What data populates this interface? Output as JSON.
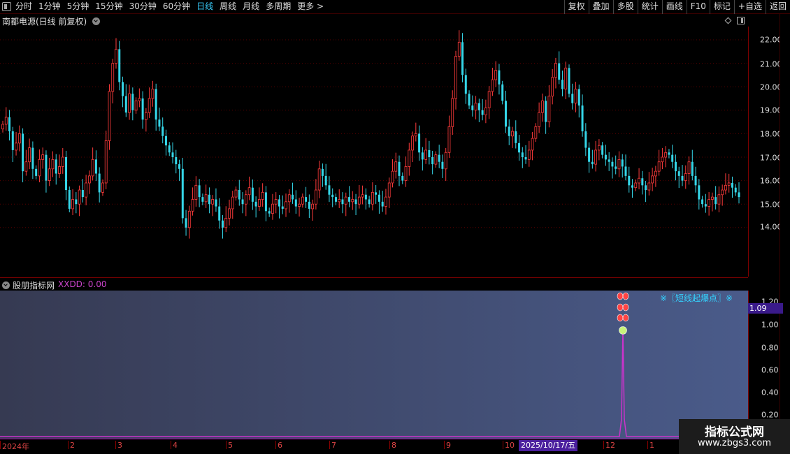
{
  "toolbar": {
    "periods": [
      "分时",
      "1分钟",
      "5分钟",
      "15分钟",
      "30分钟",
      "60分钟",
      "日线",
      "周线",
      "月线",
      "多周期",
      "更多 >"
    ],
    "active_period": "日线",
    "buttons": [
      "复权",
      "叠加",
      "多股",
      "统计",
      "画线",
      "F10",
      "标记",
      "+自选",
      "返回"
    ]
  },
  "stock": {
    "title": "南都电源(日线 前复权)"
  },
  "price_axis": [
    "22.00",
    "21.00",
    "20.00",
    "19.00",
    "18.00",
    "17.00",
    "16.00",
    "15.00",
    "14.00"
  ],
  "indicator": {
    "name": "股朋指标网",
    "value_label": "XXDD: 0.00",
    "signal_label": "※〖短线起爆点〗※",
    "axis": [
      "1.20",
      "1.00",
      "0.80",
      "0.60",
      "0.40",
      "0.20"
    ],
    "current_value": "1.09"
  },
  "date_axis": [
    "2024年",
    "2",
    "3",
    "4",
    "5",
    "6",
    "7",
    "8",
    "9",
    "10",
    "12",
    "1"
  ],
  "cursor_date": "2025/10/17/五",
  "watermark": {
    "line1": "指标公式网",
    "line2": "www.zbgs3.com"
  },
  "colors": {
    "up": "#ff3b3b",
    "down": "#35d6e8",
    "indicator_line": "#cc33cc"
  },
  "chart_data": {
    "type": "candlestick",
    "title": "南都电源(日线 前复权)",
    "ylim": [
      13.0,
      22.5
    ],
    "closes": [
      18.4,
      18.7,
      18.1,
      17.3,
      17.6,
      18.0,
      16.4,
      16.8,
      17.4,
      16.5,
      16.2,
      16.9,
      17.1,
      16.0,
      16.5,
      16.9,
      16.3,
      16.6,
      17.0,
      15.6,
      14.8,
      15.2,
      15.0,
      15.6,
      15.3,
      15.9,
      16.2,
      16.9,
      16.3,
      15.5,
      15.9,
      17.7,
      19.8,
      21.0,
      21.6,
      20.2,
      19.6,
      18.9,
      19.7,
      19.0,
      19.4,
      19.5,
      18.6,
      18.9,
      19.5,
      19.9,
      18.6,
      18.3,
      17.9,
      17.5,
      17.2,
      17.0,
      16.7,
      16.5,
      14.4,
      14.0,
      14.7,
      15.2,
      15.8,
      15.3,
      15.1,
      15.4,
      15.0,
      15.2,
      14.9,
      14.3,
      14.0,
      14.4,
      14.8,
      15.3,
      15.6,
      15.2,
      15.0,
      15.4,
      15.7,
      15.1,
      14.9,
      15.2,
      15.5,
      14.7,
      14.6,
      15.0,
      15.2,
      14.9,
      14.8,
      15.1,
      15.4,
      15.2,
      14.9,
      15.0,
      15.3,
      15.1,
      14.8,
      15.0,
      15.6,
      16.5,
      16.2,
      15.8,
      15.4,
      15.3,
      15.1,
      15.2,
      15.0,
      15.3,
      15.1,
      15.2,
      15.0,
      15.3,
      15.4,
      15.2,
      15.0,
      15.5,
      15.4,
      15.1,
      14.9,
      15.3,
      15.9,
      16.4,
      16.8,
      16.2,
      16.0,
      16.6,
      17.3,
      17.9,
      18.0,
      17.2,
      16.9,
      17.3,
      17.0,
      16.7,
      17.1,
      16.8,
      16.5,
      17.2,
      18.3,
      19.5,
      21.3,
      21.9,
      20.5,
      19.7,
      19.2,
      19.0,
      19.3,
      19.0,
      18.8,
      19.1,
      19.8,
      20.3,
      20.7,
      20.1,
      19.4,
      18.3,
      17.9,
      18.1,
      17.6,
      17.2,
      17.0,
      16.9,
      17.3,
      17.8,
      18.3,
      18.9,
      19.4,
      18.5,
      19.6,
      20.4,
      21.0,
      20.3,
      19.9,
      20.8,
      19.7,
      19.3,
      19.9,
      19.2,
      18.1,
      17.4,
      16.8,
      16.7,
      17.3,
      17.5,
      17.1,
      16.9,
      16.8,
      16.6,
      16.5,
      16.9,
      16.6,
      16.2,
      15.8,
      15.7,
      15.9,
      16.1,
      15.8,
      15.6,
      15.9,
      16.2,
      16.4,
      16.8,
      17.0,
      17.2,
      17.1,
      16.8,
      16.4,
      16.2,
      16.0,
      16.3,
      16.8,
      16.2,
      15.8,
      15.2,
      15.0,
      14.9,
      15.2,
      15.3,
      15.0,
      15.4,
      15.6,
      15.8,
      15.9,
      15.7,
      15.5,
      15.3
    ]
  }
}
